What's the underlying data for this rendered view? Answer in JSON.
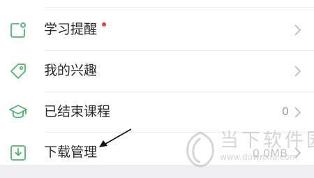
{
  "menu": {
    "items": [
      {
        "label": "学习提醒",
        "icon": "reminder-icon",
        "has_dot": true,
        "count": ""
      },
      {
        "label": "我的兴趣",
        "icon": "tag-icon",
        "has_dot": false,
        "count": ""
      },
      {
        "label": "已结束课程",
        "icon": "graduation-cap-icon",
        "has_dot": false,
        "count": "0"
      },
      {
        "label": "下载管理",
        "icon": "download-icon",
        "has_dot": false,
        "count": "0.0MB"
      }
    ]
  },
  "watermark": {
    "text": "当下软件园",
    "url": "www.downxia.com"
  },
  "colors": {
    "icon_green": "#4cb56b",
    "badge_red": "#ee3b3b",
    "text": "#2b2b2b",
    "muted": "#9a9a9a",
    "divider": "#ececec",
    "footer_band": "#efeff2"
  }
}
